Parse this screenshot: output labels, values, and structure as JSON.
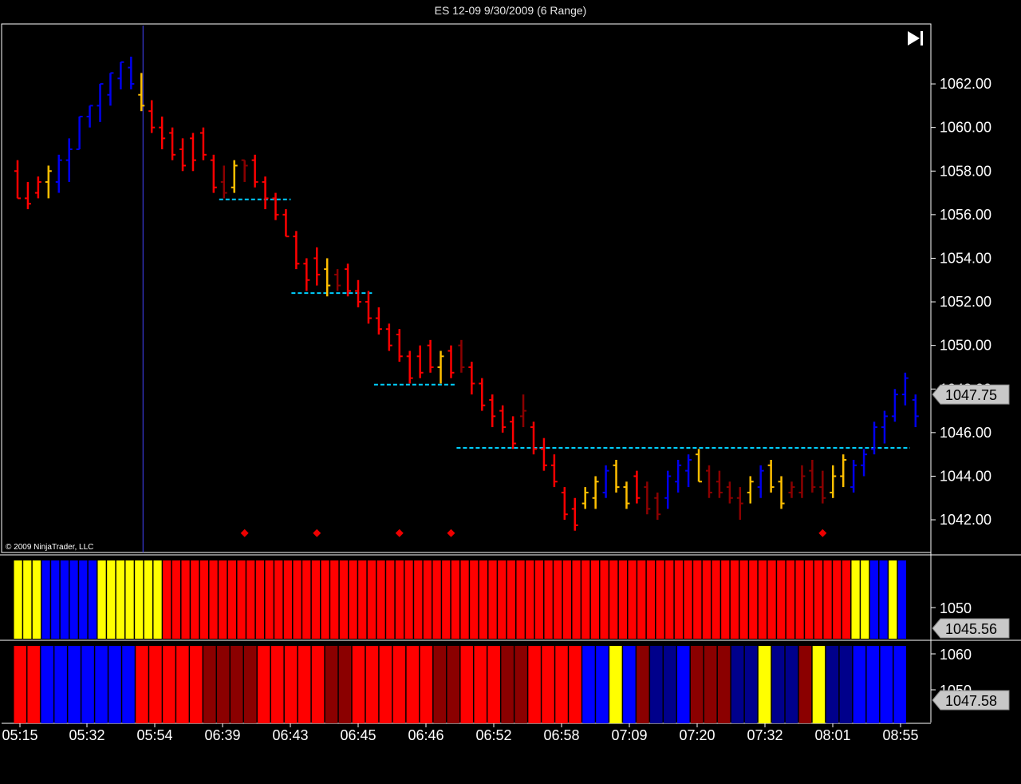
{
  "title": "ES 12-09  9/30/2009 (6 Range)",
  "copyright": "© 2009 NinjaTrader, LLC",
  "icons": {
    "play_to_end": "skip-to-end-icon"
  },
  "colors": {
    "background": "#000000",
    "frame": "#ffffff",
    "bar_red": "#ff0000",
    "bar_darkred": "#8b0000",
    "bar_yellow": "#ffbf00",
    "bar_blue": "#0000ee",
    "panel_red": "#ff0000",
    "panel_darkred": "#8b0000",
    "panel_yellow": "#ffff00",
    "panel_blue": "#0000ff",
    "panel_navy": "#00008b",
    "level_line": "#00cfff",
    "marker": "#ee0000",
    "cursor_line": "#4444ff",
    "tag_fill": "#c8c8c8"
  },
  "chart_data": {
    "type": "ohlc",
    "y_ticks": [
      "1062.00",
      "1060.00",
      "1058.00",
      "1056.00",
      "1054.00",
      "1052.00",
      "1050.00",
      "1048.00",
      "1046.00",
      "1044.00",
      "1042.00"
    ],
    "ylim": [
      1040.5,
      1064.75
    ],
    "x_tick_labels": [
      "05:15",
      "05:32",
      "05:54",
      "06:39",
      "06:43",
      "06:45",
      "06:46",
      "06:52",
      "06:58",
      "07:09",
      "07:20",
      "07:32",
      "08:01",
      "08:55"
    ],
    "last_price_tag": "1047.75",
    "bars": [
      {
        "h": 1058.5,
        "l": 1056.75,
        "o": 1058.0,
        "c": 1056.75,
        "col": "r"
      },
      {
        "h": 1057.5,
        "l": 1056.25,
        "o": 1056.75,
        "c": 1056.5,
        "col": "r"
      },
      {
        "h": 1057.75,
        "l": 1056.75,
        "o": 1057.0,
        "c": 1057.5,
        "col": "r"
      },
      {
        "h": 1058.25,
        "l": 1056.75,
        "o": 1057.5,
        "c": 1058.0,
        "col": "y"
      },
      {
        "h": 1058.75,
        "l": 1057.0,
        "o": 1057.5,
        "c": 1058.5,
        "col": "b"
      },
      {
        "h": 1059.5,
        "l": 1057.5,
        "o": 1058.5,
        "c": 1059.0,
        "col": "b"
      },
      {
        "h": 1060.5,
        "l": 1059.0,
        "o": 1059.0,
        "c": 1060.5,
        "col": "b"
      },
      {
        "h": 1061.0,
        "l": 1060.0,
        "o": 1060.5,
        "c": 1061.0,
        "col": "b"
      },
      {
        "h": 1062.0,
        "l": 1060.25,
        "o": 1061.0,
        "c": 1062.0,
        "col": "b"
      },
      {
        "h": 1062.5,
        "l": 1061.0,
        "o": 1061.5,
        "c": 1062.5,
        "col": "b"
      },
      {
        "h": 1063.0,
        "l": 1061.75,
        "o": 1062.25,
        "c": 1063.0,
        "col": "b"
      },
      {
        "h": 1063.25,
        "l": 1061.75,
        "o": 1062.75,
        "c": 1062.0,
        "col": "b"
      },
      {
        "h": 1062.5,
        "l": 1060.75,
        "o": 1061.5,
        "c": 1061.0,
        "col": "y"
      },
      {
        "h": 1061.25,
        "l": 1059.75,
        "o": 1060.75,
        "c": 1060.0,
        "col": "r"
      },
      {
        "h": 1060.5,
        "l": 1059.0,
        "o": 1060.0,
        "c": 1059.5,
        "col": "r"
      },
      {
        "h": 1060.0,
        "l": 1058.5,
        "o": 1059.75,
        "c": 1058.75,
        "col": "r"
      },
      {
        "h": 1059.5,
        "l": 1058.0,
        "o": 1059.0,
        "c": 1058.25,
        "col": "r"
      },
      {
        "h": 1059.75,
        "l": 1058.0,
        "o": 1059.5,
        "c": 1058.5,
        "col": "r"
      },
      {
        "h": 1060.0,
        "l": 1058.5,
        "o": 1059.75,
        "c": 1058.75,
        "col": "r"
      },
      {
        "h": 1058.75,
        "l": 1057.0,
        "o": 1058.5,
        "c": 1057.25,
        "col": "r"
      },
      {
        "h": 1058.25,
        "l": 1056.75,
        "o": 1057.5,
        "c": 1057.0,
        "col": "d"
      },
      {
        "h": 1058.5,
        "l": 1057.0,
        "o": 1057.25,
        "c": 1058.25,
        "col": "y"
      },
      {
        "h": 1058.5,
        "l": 1057.5,
        "o": 1058.5,
        "c": 1058.25,
        "col": "d"
      },
      {
        "h": 1058.75,
        "l": 1057.25,
        "o": 1058.5,
        "c": 1057.5,
        "col": "r"
      },
      {
        "h": 1057.75,
        "l": 1056.25,
        "o": 1057.5,
        "c": 1056.75,
        "col": "r"
      },
      {
        "h": 1057.0,
        "l": 1055.75,
        "o": 1056.75,
        "c": 1056.0,
        "col": "r"
      },
      {
        "h": 1056.25,
        "l": 1055.0,
        "o": 1056.0,
        "c": 1055.0,
        "col": "r"
      },
      {
        "h": 1055.25,
        "l": 1053.5,
        "o": 1055.0,
        "c": 1053.75,
        "col": "r"
      },
      {
        "h": 1054.0,
        "l": 1052.5,
        "o": 1053.75,
        "c": 1053.0,
        "col": "r"
      },
      {
        "h": 1054.5,
        "l": 1052.75,
        "o": 1054.0,
        "c": 1053.25,
        "col": "r"
      },
      {
        "h": 1054.0,
        "l": 1052.25,
        "o": 1053.5,
        "c": 1052.75,
        "col": "y"
      },
      {
        "h": 1053.5,
        "l": 1052.5,
        "o": 1053.25,
        "c": 1052.75,
        "col": "d"
      },
      {
        "h": 1053.75,
        "l": 1052.25,
        "o": 1053.5,
        "c": 1052.5,
        "col": "r"
      },
      {
        "h": 1053.0,
        "l": 1051.75,
        "o": 1052.5,
        "c": 1052.0,
        "col": "r"
      },
      {
        "h": 1052.5,
        "l": 1051.0,
        "o": 1052.0,
        "c": 1051.25,
        "col": "r"
      },
      {
        "h": 1051.75,
        "l": 1050.5,
        "o": 1051.25,
        "c": 1050.75,
        "col": "r"
      },
      {
        "h": 1051.0,
        "l": 1049.75,
        "o": 1050.75,
        "c": 1050.0,
        "col": "r"
      },
      {
        "h": 1050.75,
        "l": 1049.25,
        "o": 1050.5,
        "c": 1049.5,
        "col": "r"
      },
      {
        "h": 1049.75,
        "l": 1048.25,
        "o": 1049.5,
        "c": 1048.5,
        "col": "r"
      },
      {
        "h": 1050.0,
        "l": 1048.5,
        "o": 1049.5,
        "c": 1048.75,
        "col": "r"
      },
      {
        "h": 1050.25,
        "l": 1048.75,
        "o": 1050.0,
        "c": 1049.0,
        "col": "r"
      },
      {
        "h": 1049.75,
        "l": 1048.25,
        "o": 1049.0,
        "c": 1049.5,
        "col": "y"
      },
      {
        "h": 1050.0,
        "l": 1048.5,
        "o": 1049.75,
        "c": 1048.75,
        "col": "r"
      },
      {
        "h": 1050.25,
        "l": 1048.75,
        "o": 1050.0,
        "c": 1049.0,
        "col": "d"
      },
      {
        "h": 1049.25,
        "l": 1047.75,
        "o": 1049.0,
        "c": 1048.25,
        "col": "r"
      },
      {
        "h": 1048.5,
        "l": 1047.0,
        "o": 1048.25,
        "c": 1047.25,
        "col": "r"
      },
      {
        "h": 1047.75,
        "l": 1046.25,
        "o": 1047.5,
        "c": 1046.75,
        "col": "r"
      },
      {
        "h": 1047.25,
        "l": 1046.0,
        "o": 1047.0,
        "c": 1046.25,
        "col": "r"
      },
      {
        "h": 1046.75,
        "l": 1045.25,
        "o": 1046.5,
        "c": 1045.5,
        "col": "r"
      },
      {
        "h": 1047.75,
        "l": 1046.25,
        "o": 1046.75,
        "c": 1047.0,
        "col": "d"
      },
      {
        "h": 1046.5,
        "l": 1045.0,
        "o": 1046.25,
        "c": 1045.25,
        "col": "r"
      },
      {
        "h": 1045.75,
        "l": 1044.25,
        "o": 1045.25,
        "c": 1044.5,
        "col": "r"
      },
      {
        "h": 1045.0,
        "l": 1043.5,
        "o": 1044.5,
        "c": 1043.75,
        "col": "r"
      },
      {
        "h": 1043.5,
        "l": 1042.0,
        "o": 1043.25,
        "c": 1042.25,
        "col": "r"
      },
      {
        "h": 1043.0,
        "l": 1041.5,
        "o": 1042.5,
        "c": 1041.75,
        "col": "r"
      },
      {
        "h": 1043.5,
        "l": 1042.5,
        "o": 1042.75,
        "c": 1043.25,
        "col": "y"
      },
      {
        "h": 1044.0,
        "l": 1042.5,
        "o": 1043.0,
        "c": 1043.75,
        "col": "y"
      },
      {
        "h": 1044.5,
        "l": 1043.0,
        "o": 1043.25,
        "c": 1044.25,
        "col": "b"
      },
      {
        "h": 1044.75,
        "l": 1043.25,
        "o": 1044.5,
        "c": 1043.5,
        "col": "y"
      },
      {
        "h": 1043.75,
        "l": 1042.5,
        "o": 1043.5,
        "c": 1042.75,
        "col": "y"
      },
      {
        "h": 1044.25,
        "l": 1042.75,
        "o": 1044.0,
        "c": 1043.0,
        "col": "r"
      },
      {
        "h": 1043.75,
        "l": 1042.25,
        "o": 1043.5,
        "c": 1042.5,
        "col": "d"
      },
      {
        "h": 1043.25,
        "l": 1042.0,
        "o": 1043.0,
        "c": 1042.25,
        "col": "d"
      },
      {
        "h": 1044.25,
        "l": 1042.5,
        "o": 1043.0,
        "c": 1044.0,
        "col": "b"
      },
      {
        "h": 1044.75,
        "l": 1043.25,
        "o": 1043.75,
        "c": 1044.5,
        "col": "b"
      },
      {
        "h": 1045.0,
        "l": 1043.5,
        "o": 1044.25,
        "c": 1044.75,
        "col": "b"
      },
      {
        "h": 1045.25,
        "l": 1043.75,
        "o": 1045.0,
        "c": 1043.75,
        "col": "y"
      },
      {
        "h": 1044.5,
        "l": 1043.0,
        "o": 1044.25,
        "c": 1043.25,
        "col": "d"
      },
      {
        "h": 1044.25,
        "l": 1043.0,
        "o": 1043.75,
        "c": 1043.25,
        "col": "d"
      },
      {
        "h": 1043.75,
        "l": 1042.75,
        "o": 1043.5,
        "c": 1043.0,
        "col": "d"
      },
      {
        "h": 1043.5,
        "l": 1042.0,
        "o": 1043.0,
        "c": 1042.75,
        "col": "d"
      },
      {
        "h": 1044.0,
        "l": 1042.75,
        "o": 1043.25,
        "c": 1043.75,
        "col": "y"
      },
      {
        "h": 1044.5,
        "l": 1043.0,
        "o": 1043.5,
        "c": 1044.25,
        "col": "b"
      },
      {
        "h": 1044.75,
        "l": 1043.25,
        "o": 1044.5,
        "c": 1043.5,
        "col": "y"
      },
      {
        "h": 1044.0,
        "l": 1042.5,
        "o": 1043.75,
        "c": 1042.75,
        "col": "y"
      },
      {
        "h": 1043.75,
        "l": 1043.0,
        "o": 1043.25,
        "c": 1043.5,
        "col": "d"
      },
      {
        "h": 1044.5,
        "l": 1043.0,
        "o": 1043.25,
        "c": 1044.0,
        "col": "d"
      },
      {
        "h": 1044.75,
        "l": 1043.25,
        "o": 1044.25,
        "c": 1043.5,
        "col": "d"
      },
      {
        "h": 1044.25,
        "l": 1042.75,
        "o": 1043.5,
        "c": 1043.0,
        "col": "d"
      },
      {
        "h": 1044.5,
        "l": 1043.0,
        "o": 1043.25,
        "c": 1044.0,
        "col": "y"
      },
      {
        "h": 1045.0,
        "l": 1043.5,
        "o": 1044.0,
        "c": 1044.75,
        "col": "y"
      },
      {
        "h": 1044.75,
        "l": 1043.25,
        "o": 1043.5,
        "c": 1044.5,
        "col": "b"
      },
      {
        "h": 1045.25,
        "l": 1044.0,
        "o": 1044.5,
        "c": 1045.0,
        "col": "b"
      },
      {
        "h": 1046.5,
        "l": 1045.0,
        "o": 1045.25,
        "c": 1046.25,
        "col": "b"
      },
      {
        "h": 1047.0,
        "l": 1045.5,
        "o": 1046.25,
        "c": 1046.75,
        "col": "b"
      },
      {
        "h": 1048.0,
        "l": 1046.5,
        "o": 1046.75,
        "c": 1047.75,
        "col": "b"
      },
      {
        "h": 1048.75,
        "l": 1047.25,
        "o": 1047.75,
        "c": 1048.5,
        "col": "b"
      },
      {
        "h": 1047.75,
        "l": 1046.25,
        "o": 1047.5,
        "c": 1046.75,
        "col": "b"
      }
    ],
    "level_lines": [
      {
        "price": 1056.7,
        "from_bar": 20,
        "to_bar": 26
      },
      {
        "price": 1052.4,
        "from_bar": 27,
        "to_bar": 34
      },
      {
        "price": 1048.2,
        "from_bar": 35,
        "to_bar": 42
      },
      {
        "price": 1045.3,
        "from_bar": 43,
        "to_bar": 86
      }
    ],
    "markers": [
      {
        "bar": 22,
        "price": 1041.5
      },
      {
        "bar": 29,
        "price": 1041.5
      },
      {
        "bar": 37,
        "price": 1041.5
      },
      {
        "bar": 42,
        "price": 1041.5
      },
      {
        "bar": 78,
        "price": 1041.5
      }
    ],
    "cursor_bar": 12,
    "panel1": {
      "label": "1050",
      "value_tag": "1045.56",
      "colors": [
        "y",
        "y",
        "y",
        "b",
        "b",
        "b",
        "b",
        "b",
        "b",
        "y",
        "y",
        "y",
        "y",
        "y",
        "y",
        "y",
        "r",
        "r",
        "r",
        "r",
        "r",
        "r",
        "r",
        "r",
        "r",
        "r",
        "r",
        "r",
        "r",
        "r",
        "r",
        "r",
        "r",
        "r",
        "r",
        "r",
        "r",
        "r",
        "r",
        "r",
        "r",
        "r",
        "r",
        "r",
        "r",
        "r",
        "r",
        "r",
        "r",
        "r",
        "r",
        "r",
        "r",
        "r",
        "r",
        "r",
        "r",
        "r",
        "r",
        "r",
        "r",
        "r",
        "r",
        "r",
        "r",
        "r",
        "r",
        "r",
        "r",
        "r",
        "r",
        "r",
        "r",
        "r",
        "r",
        "r",
        "r",
        "r",
        "r",
        "r",
        "r",
        "r",
        "r",
        "r",
        "r",
        "r",
        "r",
        "r",
        "r",
        "r",
        "y",
        "y",
        "b",
        "b",
        "y",
        "b"
      ]
    },
    "panel2": {
      "labels": [
        "1060",
        "1050"
      ],
      "value_tag": "1047.58",
      "colors": [
        "r",
        "r",
        "b",
        "b",
        "b",
        "b",
        "b",
        "b",
        "b",
        "r",
        "r",
        "r",
        "r",
        "r",
        "d",
        "d",
        "d",
        "d",
        "r",
        "r",
        "r",
        "r",
        "r",
        "d",
        "d",
        "r",
        "r",
        "r",
        "r",
        "r",
        "r",
        "d",
        "d",
        "r",
        "r",
        "r",
        "d",
        "d",
        "r",
        "r",
        "r",
        "r",
        "b",
        "b",
        "y",
        "b",
        "d",
        "n",
        "n",
        "b",
        "d",
        "d",
        "d",
        "n",
        "n",
        "y",
        "n",
        "n",
        "d",
        "y",
        "n",
        "n",
        "b",
        "b",
        "b",
        "b"
      ]
    }
  }
}
